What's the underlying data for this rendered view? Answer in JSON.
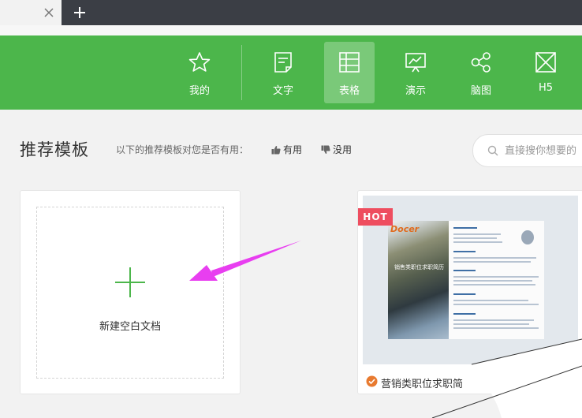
{
  "browser": {
    "new_tab_symbol": "+"
  },
  "toolbar": {
    "items": [
      {
        "label": "我的",
        "icon": "star-icon",
        "active": false
      },
      {
        "label": "文字",
        "icon": "document-text-icon",
        "active": false
      },
      {
        "label": "表格",
        "icon": "spreadsheet-icon",
        "active": true
      },
      {
        "label": "演示",
        "icon": "presentation-icon",
        "active": false
      },
      {
        "label": "脑图",
        "icon": "mindmap-icon",
        "active": false
      },
      {
        "label": "H5",
        "icon": "h5-icon",
        "active": false
      }
    ],
    "color": "#4cb64b"
  },
  "heading": {
    "title": "推荐模板",
    "prompt": "以下的推荐模板对您是否有用：",
    "useful": "有用",
    "useless": "没用"
  },
  "search": {
    "placeholder": "直接搜你想要的"
  },
  "blank_card": {
    "label": "新建空白文档"
  },
  "template_card": {
    "badge": "HOT",
    "name": "营销类职位求职简",
    "thumb_logo": "Docer",
    "thumb_title": "销售类职位求职简历",
    "badge_color": "#ee4d5f"
  },
  "annotation": {
    "arrow_color": "#e83ef0"
  }
}
